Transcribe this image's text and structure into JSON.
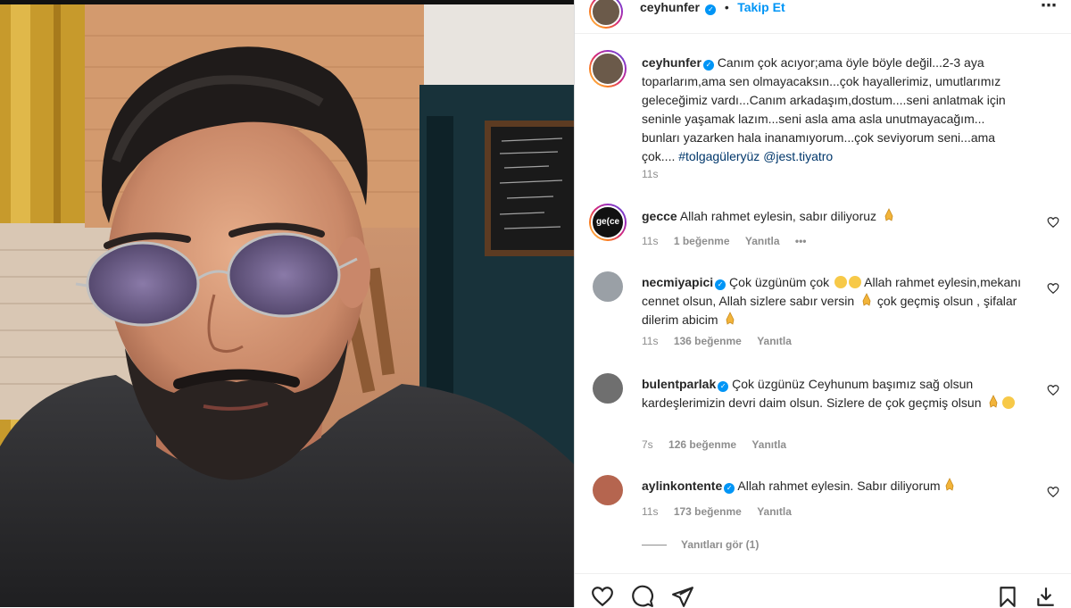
{
  "post": {
    "author": "ceyhunfer",
    "follow_label": "Takip Et",
    "dot": "•",
    "more_label": "⋯",
    "caption": {
      "text": "Canım çok acıyor;ama öyle böyle değil...2-3 aya toparlarım,ama sen olmayacaksın...çok hayallerimiz, umutlarımız geleceğimiz vardı...Canım arkadaşım,dostum....seni anlatmak için seninle yaşamak lazım...seni asla ama asla unutmayacağım... bunları yazarken hala inanamıyorum...çok seviyorum seni...ama çok....",
      "hashtag": "#tolgagüleryüz",
      "mention": "@jest.tiyatro",
      "time": "11s"
    }
  },
  "comments": [
    {
      "username": "gecce",
      "avatar_text": "ge(ce",
      "text": "Allah rahmet eylesin, sabır diliyoruz",
      "time": "11s",
      "likes": "1 beğenme",
      "reply": "Yanıtla",
      "more": "•••"
    },
    {
      "username": "necmiyapici",
      "text_line1": "Çok üzgünüm çok",
      "text_rest": "Allah rahmet eylesin,mekanı cennet olsun, Allah sizlere sabır versin",
      "text_end": "çok geçmiş olsun , şifalar dilerim abicim",
      "time": "11s",
      "likes": "136 beğenme",
      "reply": "Yanıtla"
    },
    {
      "username": "bulentparlak",
      "text": "Çok üzgünüz Ceyhunum başımız sağ olsun kardeşlerimizin devri daim olsun. Sizlere de çok geçmiş olsun",
      "time": "7s",
      "likes": "126 beğenme",
      "reply": "Yanıtla"
    },
    {
      "username": "aylinkontente",
      "text": "Allah rahmet eylesin. Sabır diliyorum",
      "time": "11s",
      "likes": "173 beğenme",
      "reply": "Yanıtla"
    }
  ],
  "view_replies": "Yanıtları gör (1)",
  "colors": {
    "link": "#0095f6",
    "muted": "#8e8e8e",
    "hashtag": "#00376b"
  },
  "icons": [
    "heart-icon",
    "comment-icon",
    "share-icon",
    "bookmark-icon",
    "download-icon",
    "verified-icon",
    "pray-emoji",
    "sad-emoji"
  ]
}
